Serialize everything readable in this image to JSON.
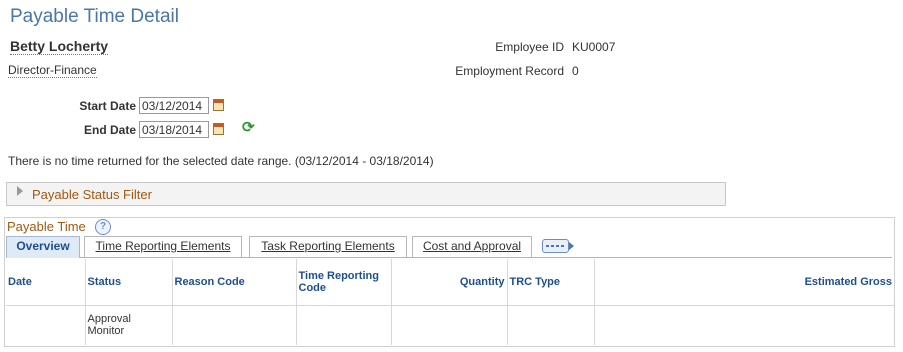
{
  "page_title": "Payable Time Detail",
  "employee": {
    "name": "Betty Locherty",
    "job_title": "Director-Finance",
    "id_label": "Employee ID",
    "id_value": "KU0007",
    "record_label": "Employment Record",
    "record_value": "0"
  },
  "dates": {
    "start_label": "Start Date",
    "start_value": "03/12/2014",
    "end_label": "End Date",
    "end_value": "03/18/2014"
  },
  "message": "There is no time returned for the selected date range. (03/12/2014 - 03/18/2014)",
  "filter_section": {
    "title": "Payable Status Filter"
  },
  "grid": {
    "title": "Payable Time",
    "help_glyph": "?",
    "tabs": [
      {
        "label": "Overview",
        "active": true
      },
      {
        "label": "Time Reporting Elements",
        "active": false
      },
      {
        "label": "Task Reporting Elements",
        "active": false
      },
      {
        "label": "Cost and Approval",
        "active": false
      }
    ],
    "columns": [
      "Date",
      "Status",
      "Reason Code",
      "Time Reporting Code",
      "Quantity",
      "TRC Type",
      "Estimated Gross"
    ],
    "rows": [
      {
        "date": "",
        "status": "Approval Monitor",
        "reason_code": "",
        "trc": "",
        "quantity": "",
        "trc_type": "",
        "estimated_gross": ""
      }
    ]
  },
  "icons": {
    "calendar": "calendar-icon",
    "refresh": "refresh-icon",
    "expand": "expand-arrow-icon",
    "help": "help-icon",
    "tab_menu": "show-all-columns-icon"
  },
  "colors": {
    "title_blue": "#4a76a8",
    "section_orange": "#a05a10",
    "header_blue": "#1f4f8a",
    "refresh_green": "#2c9a2c"
  }
}
